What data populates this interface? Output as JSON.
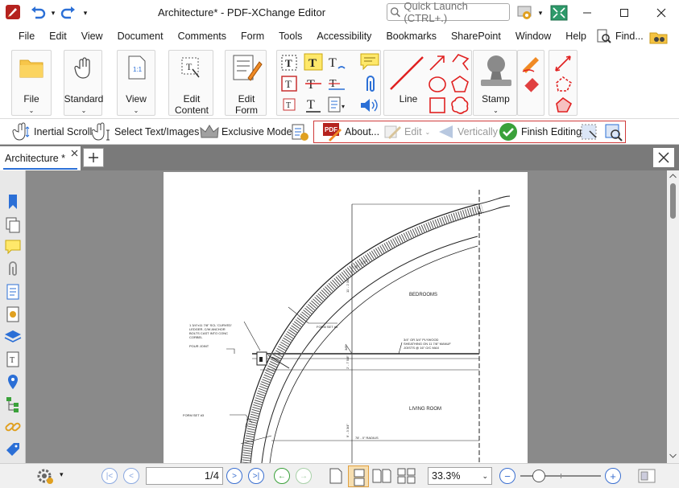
{
  "window": {
    "title": "Architecture* - PDF-XChange Editor",
    "quick_launch_placeholder": "Quick Launch (CTRL+.)"
  },
  "menu": [
    "File",
    "Edit",
    "View",
    "Document",
    "Comments",
    "Form",
    "Tools",
    "Accessibility",
    "Bookmarks",
    "SharePoint",
    "Window",
    "Help"
  ],
  "menu_right": {
    "find_label": "Find..."
  },
  "ribbon": {
    "file": "File",
    "standard": "Standard",
    "view": "View",
    "edit_content_1": "Edit",
    "edit_content_2": "Content",
    "edit_form_1": "Edit",
    "edit_form_2": "Form",
    "line": "Line",
    "stamp": "Stamp"
  },
  "toolbar": {
    "inertial_scroll": "Inertial Scroll",
    "select_text": "Select Text/Images",
    "exclusive_mode": "Exclusive Mode",
    "about": "About...",
    "edit": "Edit",
    "vertically": "Vertically",
    "finish_editing": "Finish Editing"
  },
  "tabs": [
    {
      "label": "Architecture *"
    }
  ],
  "drawing": {
    "bedrooms": "BEDROOMS",
    "living_room": "LIVING ROOM",
    "note_curved_1": "1 3/4\"x11 7/8\" SCL 'CURVED'",
    "note_curved_2": "LEDGER, C/W ANCHOR",
    "note_curved_3": "BOLTS CAST INTO CONC",
    "note_curved_4": "CORBEL",
    "pour_joint": "POUR JOINT",
    "form_set_a": "FORM SET #3",
    "form_set_b": "FORM SET #3",
    "plywood_1": "3/4\" OR 3/4\" PLYWOOD",
    "plywood_2": "SHEATHING ON 11 7/8\" MANUF",
    "plywood_3": "JOISTS @ 16\" O/C MAX",
    "radius": "78' - 0\" RADIUS",
    "dim_a": "15' - 3 3/4\"",
    "dim_b": "11' - 2 3/8\"",
    "dim_c": "3/8\"",
    "dim_d": "2' - 7 5/8\"",
    "dim_e": "9' - 3 3/4\"",
    "dim_f": "79' - 0\""
  },
  "status": {
    "page_display": "1/4",
    "zoom": "33.3%"
  },
  "colors": {
    "accent_blue": "#3a6fd0",
    "annotation_red": "#e02020",
    "tab_bar": "#7a7a7a",
    "viewer_bg": "#8a8a8a",
    "finish_green": "#3aa13a"
  }
}
